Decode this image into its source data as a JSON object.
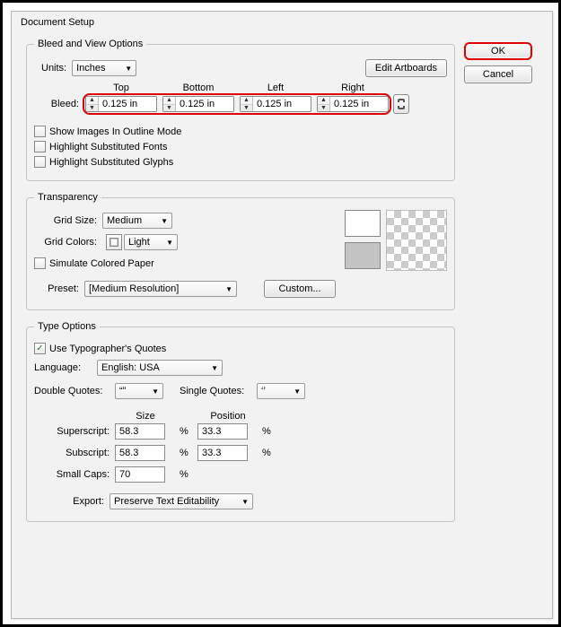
{
  "dialog_title": "Document Setup",
  "buttons": {
    "ok": "OK",
    "cancel": "Cancel"
  },
  "bleed_view": {
    "legend": "Bleed and View Options",
    "units_label": "Units:",
    "units_value": "Inches",
    "edit_artboards": "Edit Artboards",
    "bleed_label": "Bleed:",
    "cols": {
      "top": "Top",
      "bottom": "Bottom",
      "left": "Left",
      "right": "Right"
    },
    "values": {
      "top": "0.125 in",
      "bottom": "0.125 in",
      "left": "0.125 in",
      "right": "0.125 in"
    },
    "show_outline": "Show Images In Outline Mode",
    "hi_fonts": "Highlight Substituted Fonts",
    "hi_glyphs": "Highlight Substituted Glyphs"
  },
  "transparency": {
    "legend": "Transparency",
    "grid_size_label": "Grid Size:",
    "grid_size_value": "Medium",
    "grid_colors_label": "Grid Colors:",
    "grid_colors_value": "Light",
    "simulate": "Simulate Colored Paper",
    "preset_label": "Preset:",
    "preset_value": "[Medium Resolution]",
    "custom": "Custom..."
  },
  "type_options": {
    "legend": "Type Options",
    "typographers": "Use Typographer's Quotes",
    "language_label": "Language:",
    "language_value": "English: USA",
    "double_label": "Double Quotes:",
    "double_value": "“”",
    "single_label": "Single Quotes:",
    "single_value": "‘’",
    "size_col": "Size",
    "pos_col": "Position",
    "superscript_label": "Superscript:",
    "superscript_size": "58.3",
    "superscript_pos": "33.3",
    "subscript_label": "Subscript:",
    "subscript_size": "58.3",
    "subscript_pos": "33.3",
    "smallcaps_label": "Small Caps:",
    "smallcaps_size": "70",
    "export_label": "Export:",
    "export_value": "Preserve Text Editability",
    "pct": "%"
  }
}
